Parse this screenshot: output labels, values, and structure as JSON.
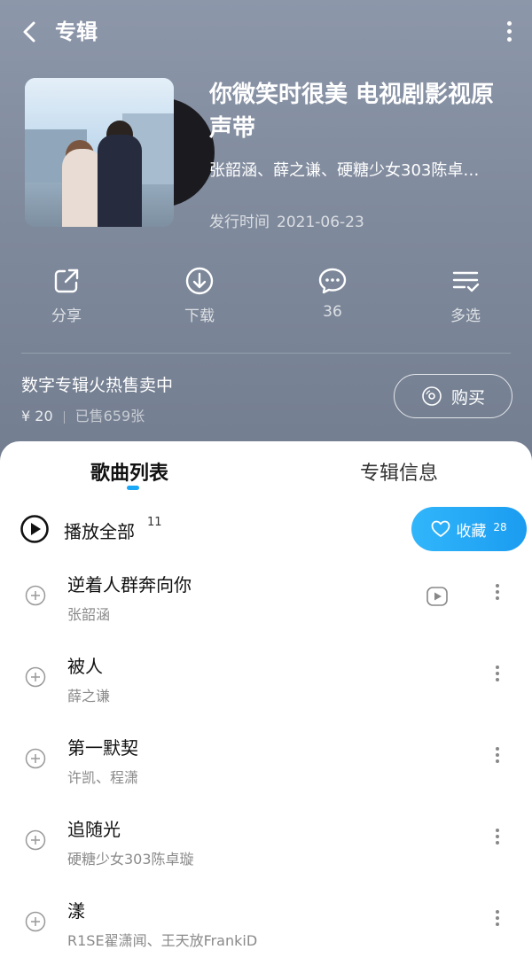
{
  "topbar": {
    "title": "专辑"
  },
  "album": {
    "title": "你微笑时很美 电视剧影视原声带",
    "artists": "张韶涵、薛之谦、硬糖少女303陈卓…",
    "release_label": "发行时间",
    "release_date": "2021-06-23"
  },
  "actions": [
    {
      "label": "分享",
      "icon": "share-icon"
    },
    {
      "label": "下载",
      "icon": "download-icon"
    },
    {
      "label": "36",
      "icon": "comment-icon"
    },
    {
      "label": "多选",
      "icon": "multi-select-icon"
    }
  ],
  "promo": {
    "title": "数字专辑火热售卖中",
    "price": "¥ 20",
    "sold": "已售659张",
    "buy_label": "购买"
  },
  "tabs": {
    "songs": "歌曲列表",
    "info": "专辑信息"
  },
  "playall": {
    "label": "播放全部",
    "count": "11"
  },
  "favorite": {
    "label": "收藏",
    "count": "28"
  },
  "songs": [
    {
      "name": "逆着人群奔向你",
      "artist": "张韶涵",
      "has_mv": true
    },
    {
      "name": "被人",
      "artist": "薛之谦",
      "has_mv": false
    },
    {
      "name": "第一默契",
      "artist": "许凯、程潇",
      "has_mv": false
    },
    {
      "name": "追随光",
      "artist": "硬糖少女303陈卓璇",
      "has_mv": false
    },
    {
      "name": "漾",
      "artist": "R1SE翟潇闻、王天放FrankiD",
      "has_mv": false
    }
  ],
  "colors": {
    "accent": "#1aa7f5",
    "header_bg": "#8290a3"
  }
}
